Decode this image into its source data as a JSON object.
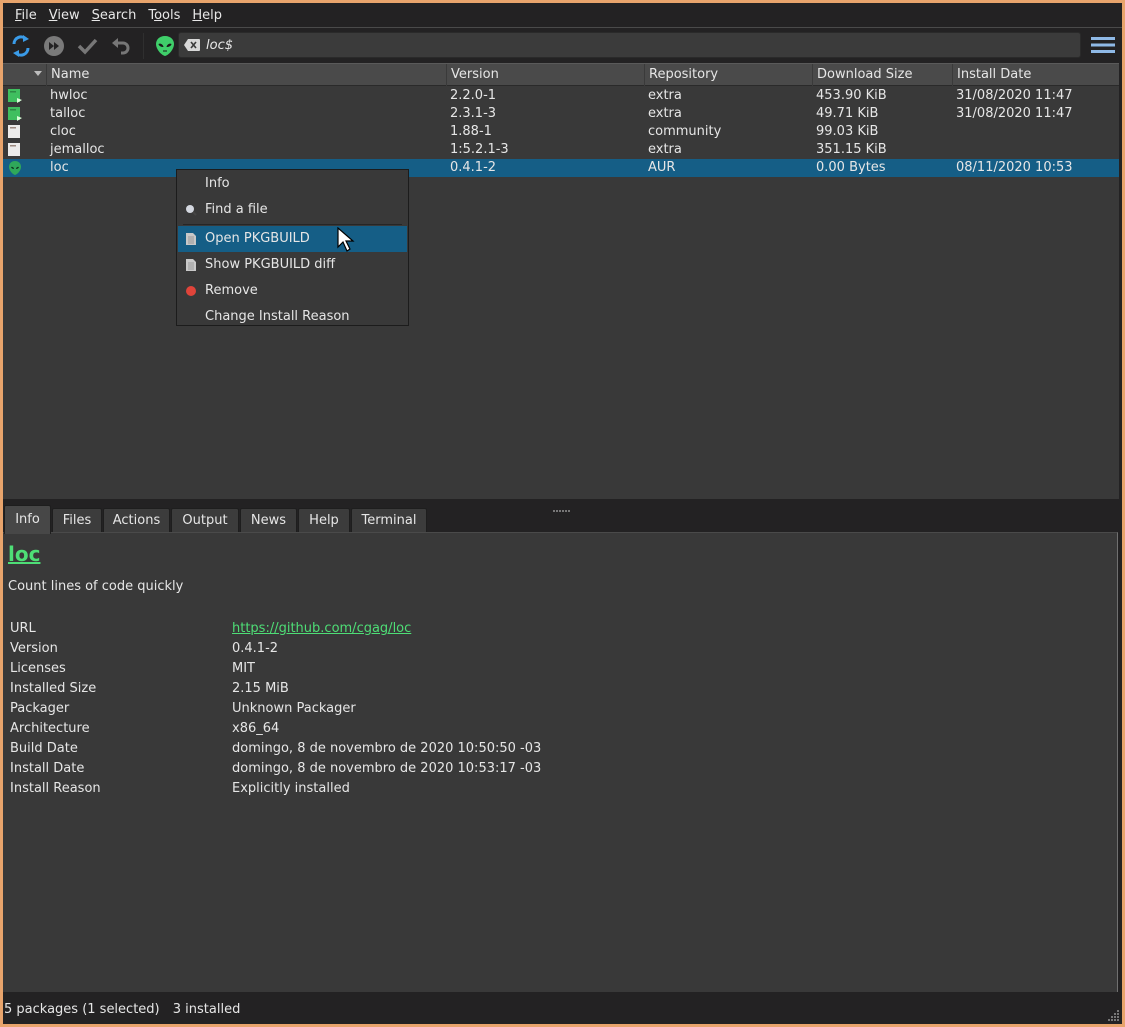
{
  "menubar": {
    "items": [
      {
        "label": "File",
        "mnemonic": "F",
        "rest": "ile"
      },
      {
        "label": "View",
        "mnemonic": "V",
        "rest": "iew"
      },
      {
        "label": "Search",
        "mnemonic": "S",
        "rest": "earch"
      },
      {
        "label": "Tools",
        "mnemonic": "T",
        "rest": "ools"
      },
      {
        "label": "Help",
        "mnemonic": "H",
        "rest": "elp"
      }
    ]
  },
  "toolbar": {
    "buttons": [
      {
        "name": "sync-databases",
        "icon": "sync-icon"
      },
      {
        "name": "system-upgrade",
        "icon": "fast-forward-icon"
      },
      {
        "name": "commit",
        "icon": "check-icon"
      },
      {
        "name": "rollback",
        "icon": "undo-icon"
      },
      {
        "name": "aur-mode",
        "icon": "alien-icon"
      }
    ],
    "search": {
      "value": "loc$",
      "placeholder": ""
    },
    "menu_icon": "hamburger-icon"
  },
  "table": {
    "columns": [
      "",
      "Name",
      "Version",
      "Repository",
      "Download Size",
      "Install Date"
    ],
    "rows": [
      {
        "icon": "installed-icon",
        "name": "hwloc",
        "version": "2.2.0-1",
        "repository": "extra",
        "download_size": "453.90 KiB",
        "install_date": "31/08/2020 11:47",
        "selected": false
      },
      {
        "icon": "installed-icon",
        "name": "talloc",
        "version": "2.3.1-3",
        "repository": "extra",
        "download_size": "49.71 KiB",
        "install_date": "31/08/2020 11:47",
        "selected": false
      },
      {
        "icon": "not-installed-icon",
        "name": "cloc",
        "version": "1.88-1",
        "repository": "community",
        "download_size": "99.03 KiB",
        "install_date": "",
        "selected": false
      },
      {
        "icon": "not-installed-icon",
        "name": "jemalloc",
        "version": "1:5.2.1-3",
        "repository": "extra",
        "download_size": "351.15 KiB",
        "install_date": "",
        "selected": false
      },
      {
        "icon": "aur-icon",
        "name": "loc",
        "version": "0.4.1-2",
        "repository": "AUR",
        "download_size": "0.00 Bytes",
        "install_date": "08/11/2020 10:53",
        "selected": true
      }
    ]
  },
  "context_menu": {
    "items": [
      {
        "label": "Info",
        "icon": ""
      },
      {
        "label": "Find a file",
        "icon": "search-icon"
      },
      {
        "label": "Open PKGBUILD",
        "icon": "document-icon",
        "highlighted": true
      },
      {
        "label": "Show PKGBUILD diff",
        "icon": "document-icon"
      },
      {
        "label": "Remove",
        "icon": "remove-icon"
      },
      {
        "label": "Change Install Reason",
        "icon": ""
      }
    ]
  },
  "tabs": [
    {
      "label": "Info",
      "active": true
    },
    {
      "label": "Files"
    },
    {
      "label": "Actions"
    },
    {
      "label": "Output"
    },
    {
      "label": "News"
    },
    {
      "label": "Help"
    },
    {
      "label": "Terminal"
    }
  ],
  "info": {
    "name": "loc",
    "description": "Count lines of code quickly",
    "properties": [
      {
        "key": "URL",
        "value": "https://github.com/cgag/loc",
        "link": true
      },
      {
        "key": "Version",
        "value": "0.4.1-2"
      },
      {
        "key": "Licenses",
        "value": "MIT"
      },
      {
        "key": "Installed Size",
        "value": "2.15 MiB"
      },
      {
        "key": "Packager",
        "value": "Unknown Packager"
      },
      {
        "key": "Architecture",
        "value": "x86_64"
      },
      {
        "key": "Build Date",
        "value": "domingo, 8 de novembro de 2020 10:50:50 -03"
      },
      {
        "key": "Install Date",
        "value": "domingo, 8 de novembro de 2020 10:53:17 -03"
      },
      {
        "key": "Install Reason",
        "value": "Explicitly installed"
      }
    ]
  },
  "statusbar": {
    "packages": "5 packages (1 selected)",
    "installed": "3 installed"
  },
  "colors": {
    "accent": "#155e86",
    "link": "#4ede76",
    "sync_blue": "#3a9be8",
    "aur_green": "#3fcf6a",
    "remove_red": "#e0443a"
  }
}
